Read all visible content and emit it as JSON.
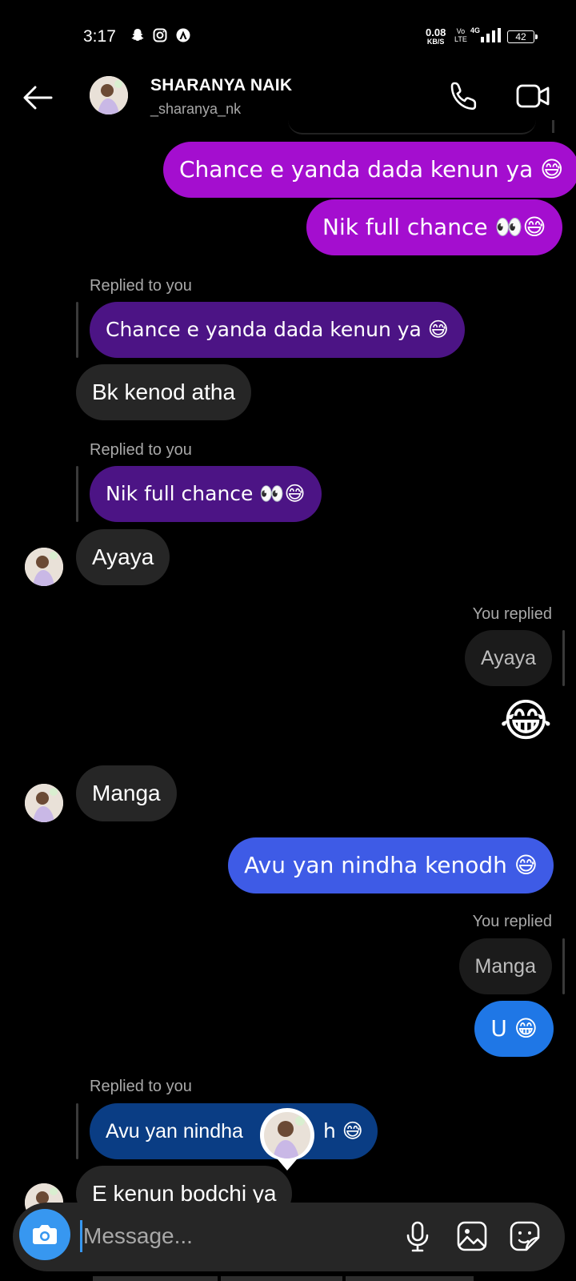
{
  "status": {
    "time": "3:17",
    "net_speed_value": "0.08",
    "net_speed_unit": "KB/S",
    "volte_top": "Vo",
    "volte_bottom": "LTE",
    "network_type": "4G",
    "battery": "42"
  },
  "header": {
    "name": "SHARANYA NAIK",
    "username": "_sharanya_nk"
  },
  "messages": {
    "m1": "Chance e yanda dada kenun ya 😅",
    "m2": "Nik full chance 👀😅",
    "r1_label": "Replied to you",
    "r1_quote": "Chance e yanda dada kenun ya 😅",
    "m3": "Bk kenod atha",
    "r2_label": "Replied to you",
    "r2_quote": "Nik full chance 👀😅",
    "m4": "Ayaya",
    "yr1_label": "You replied",
    "yr1_quote": "Ayaya",
    "m5": "😂",
    "m6": "Manga",
    "m7": "Avu yan nindha kenodh 😅",
    "yr2_label": "You replied",
    "yr2_quote": "Manga",
    "m8": "U 😁",
    "r3_label": "Replied to you",
    "r3_quote_a": "Avu yan nindha",
    "r3_quote_b": "h 😅",
    "m9": "E kenun bodchi ya"
  },
  "composer": {
    "placeholder": "Message..."
  },
  "colors": {
    "sent_purple": "#a40ecf",
    "reply_quote_purple": "#4c1485",
    "sent_blue": "#3e5be6",
    "sent_bright_blue": "#1f77e6",
    "reply_quote_blue": "#0a3d84",
    "received_gray": "#262626",
    "camera_blue": "#3797f0"
  }
}
